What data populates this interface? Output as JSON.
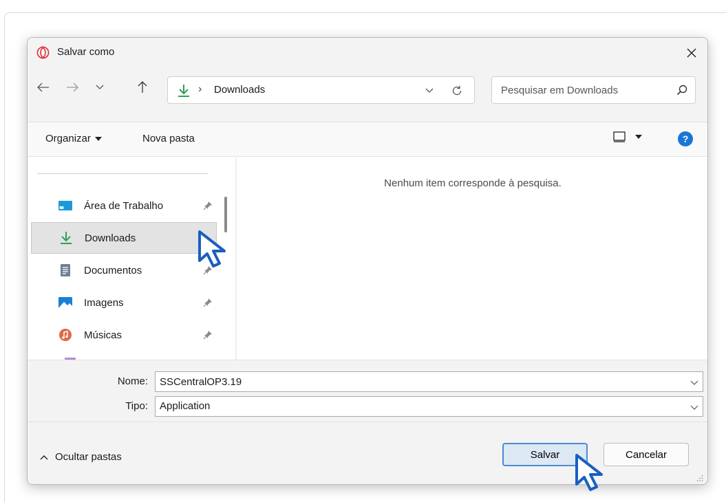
{
  "window": {
    "title": "Salvar como"
  },
  "address_bar": {
    "current_folder": "Downloads",
    "separator": "›"
  },
  "search": {
    "placeholder": "Pesquisar em Downloads"
  },
  "toolbar": {
    "organize_label": "Organizar",
    "new_folder_label": "Nova pasta",
    "help_label": "?"
  },
  "sidebar": {
    "items": [
      {
        "label": "Área de Trabalho",
        "icon": "desktop-icon",
        "pinned": true,
        "selected": false
      },
      {
        "label": "Downloads",
        "icon": "download-icon",
        "pinned": true,
        "selected": true
      },
      {
        "label": "Documentos",
        "icon": "document-icon",
        "pinned": true,
        "selected": false
      },
      {
        "label": "Imagens",
        "icon": "image-icon",
        "pinned": true,
        "selected": false
      },
      {
        "label": "Músicas",
        "icon": "music-icon",
        "pinned": true,
        "selected": false
      }
    ]
  },
  "content": {
    "empty_message": "Nenhum item corresponde à pesquisa."
  },
  "fields": {
    "name_label": "Nome:",
    "name_value": "SSCentralOP3.19",
    "type_label": "Tipo:",
    "type_value": "Application"
  },
  "footer": {
    "hide_folders_label": "Ocultar pastas",
    "save_label": "Salvar",
    "cancel_label": "Cancelar"
  },
  "colors": {
    "accent": "#1877d6",
    "download_green": "#2e9e5a",
    "opera_red": "#e0242e",
    "selected_bg": "#e3e3e3"
  }
}
